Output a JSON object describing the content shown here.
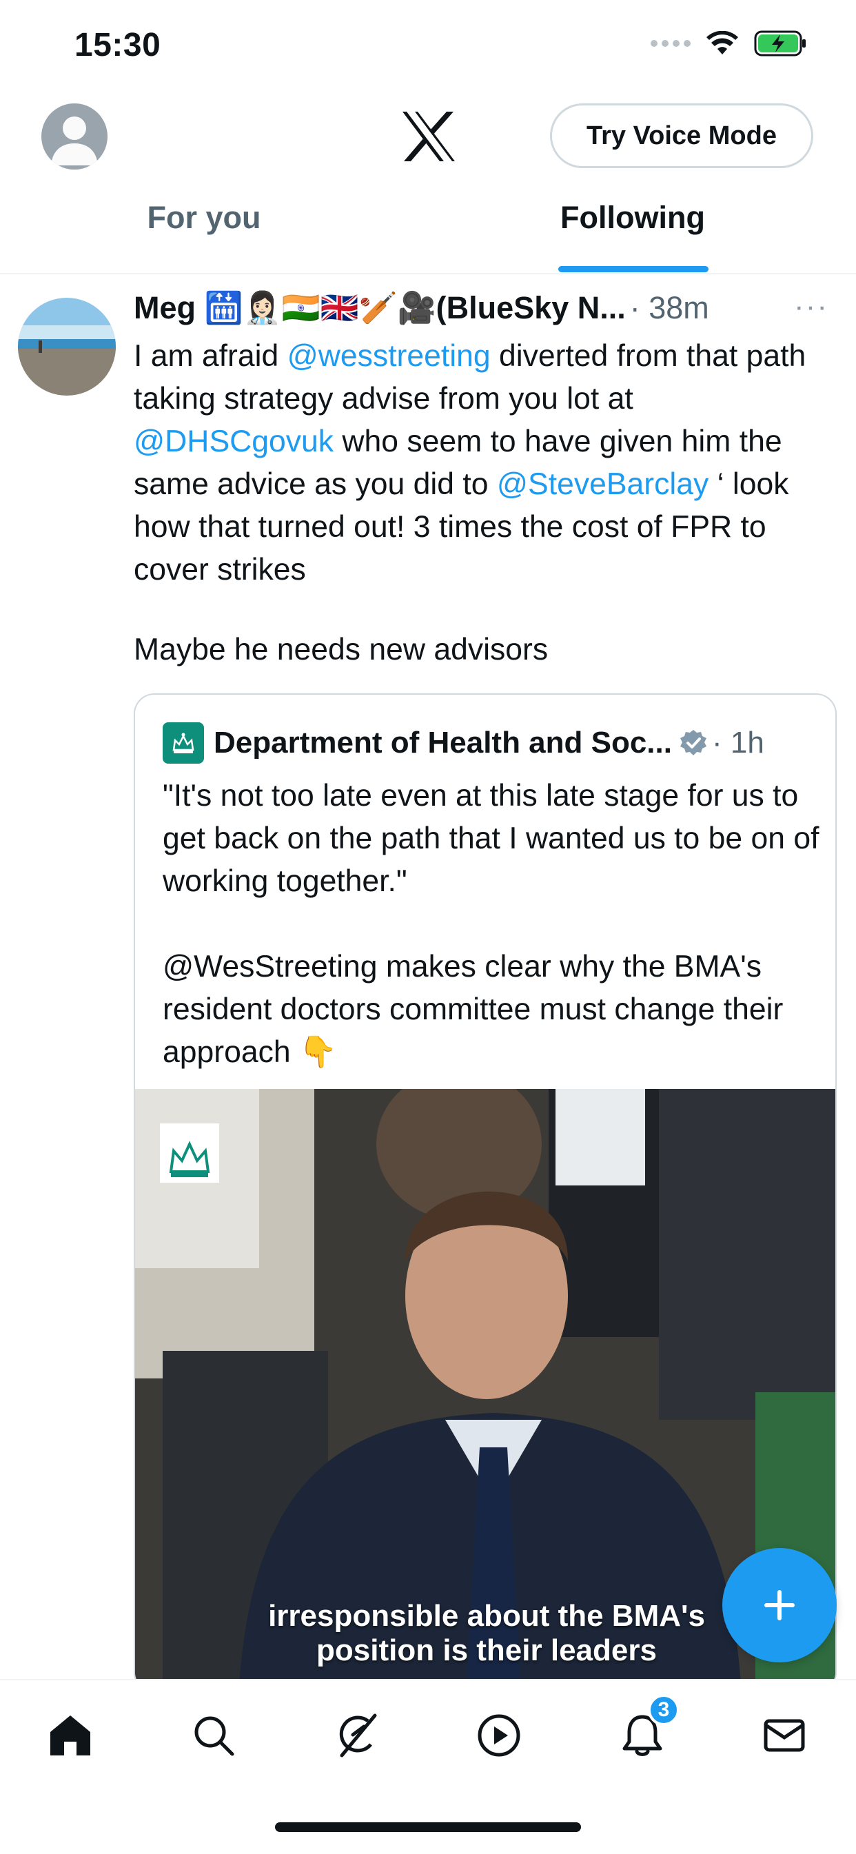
{
  "status_bar": {
    "time": "15:30"
  },
  "header": {
    "voice_button_label": "Try Voice Mode"
  },
  "tabs": [
    {
      "label": "For you",
      "active": false
    },
    {
      "label": "Following",
      "active": true
    }
  ],
  "tweet": {
    "author_name": "Meg 🛗👩🏻‍⚕️🇮🇳🇬🇧🏏🎥(BlueSky N...",
    "meta": "· 38m",
    "more": "···",
    "text_parts": {
      "p1": "I am afraid ",
      "m1": "@wesstreeting",
      "p2": " diverted from that path taking strategy advise from you lot at ",
      "m2": "@DHSCgovuk",
      "p3": " who seem to have given him the same advice as you did to ",
      "m3": "@SteveBarclay",
      "p4": " ‘ look how that turned out! 3 times the cost of FPR to cover strikes"
    },
    "text_line2": "Maybe he needs new advisors",
    "quote": {
      "author_name": "Department of Health and Soc...",
      "meta": "· 1h",
      "text": "\"It's not too late even at this late stage for us to get back on the path that I wanted us to be on of working together.\"\n\n@WesStreeting makes clear why the BMA's resident doctors committee must change their approach 👇",
      "video_caption_line1": "irresponsible about the BMA's",
      "video_caption_line2": "position is their leaders"
    }
  },
  "bottom_nav": {
    "notification_count": "3"
  },
  "colors": {
    "accent": "#1d9bf0",
    "text": "#0f1419",
    "muted": "#536471",
    "dhsc": "#0e8f7b"
  }
}
